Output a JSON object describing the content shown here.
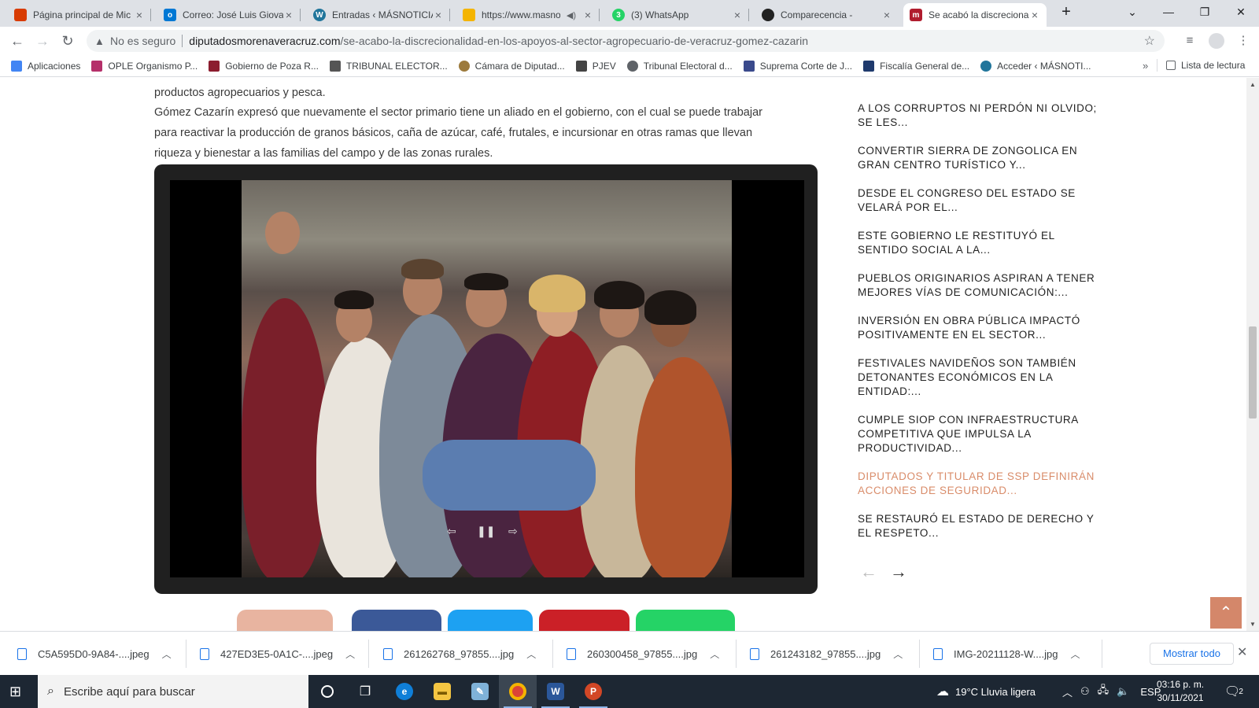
{
  "tabs": [
    {
      "title": "Página principal de Mic",
      "icon": "office-icon",
      "color": "#d83b01"
    },
    {
      "title": "Correo: José Luis Giova",
      "icon": "outlook-icon",
      "color": "#0078d4"
    },
    {
      "title": "Entradas ‹ MÁSNOTICIA",
      "icon": "wordpress-icon",
      "color": "#21759b"
    },
    {
      "title": "https://www.masno",
      "icon": "drive-icon",
      "color": "#f4b400"
    },
    {
      "title": "(3) WhatsApp",
      "icon": "whatsapp-icon",
      "color": "#25d366",
      "badge": "3"
    },
    {
      "title": "Comparecencia -",
      "icon": "camera-aperture-icon",
      "color": "#222222"
    },
    {
      "title": "Se acabó la discreciona",
      "icon": "morena-icon",
      "color": "#b01c2e",
      "badge": "m"
    }
  ],
  "toolbar": {
    "security_label": "No es seguro",
    "url_host": "diputadosmorenaveracruz.com",
    "url_path": "/se-acabo-la-discrecionalidad-en-los-apoyos-al-sector-agropecuario-de-veracruz-gomez-cazarin"
  },
  "bookmarks": [
    {
      "label": "Aplicaciones",
      "icon": "apps-grid-icon",
      "color": "#4285f4"
    },
    {
      "label": "OPLE Organismo P...",
      "icon": "ople-icon",
      "color": "#b5306a"
    },
    {
      "label": "Gobierno de Poza R...",
      "icon": "poza-rica-icon",
      "color": "#8c1d2f"
    },
    {
      "label": "TRIBUNAL ELECTOR...",
      "icon": "tribunal-icon",
      "color": "#555555"
    },
    {
      "label": "Cámara de Diputad...",
      "icon": "camara-icon",
      "color": "#9c7a3c"
    },
    {
      "label": "PJEV",
      "icon": "pjev-icon",
      "color": "#444444"
    },
    {
      "label": "Tribunal Electoral d...",
      "icon": "globe-icon",
      "color": "#5f6368"
    },
    {
      "label": "Suprema Corte de J...",
      "icon": "scjn-icon",
      "color": "#3a4a8c"
    },
    {
      "label": "Fiscalía General de...",
      "icon": "fiscalia-icon",
      "color": "#1f3a6d"
    },
    {
      "label": "Acceder ‹ MÁSNOTI...",
      "icon": "wordpress-icon",
      "color": "#21759b"
    }
  ],
  "reading_list_label": "Lista de lectura",
  "article": {
    "p1": "productos agropecuarios y pesca.",
    "p2_line1": "Gómez Cazarín expresó que nuevamente el sector primario tiene un aliado en el gobierno, con el cual se puede trabajar",
    "p2_line2": "para reactivar la producción de granos básicos, caña de azúcar, café, frutales, e incursionar en otras ramas que llevan",
    "p2_line3": "riqueza y bienestar a las familias del campo y de las zonas rurales."
  },
  "sidebar": {
    "items": [
      "A LOS CORRUPTOS NI PERDÓN NI OLVIDO; SE LES...",
      "CONVERTIR SIERRA DE ZONGOLICA EN GRAN CENTRO TURÍSTICO Y...",
      "DESDE EL CONGRESO DEL ESTADO SE VELARÁ POR EL...",
      "ESTE GOBIERNO LE RESTITUYÓ EL SENTIDO SOCIAL A LA...",
      "PUEBLOS ORIGINARIOS ASPIRAN A TENER MEJORES VÍAS DE COMUNICACIÓN:...",
      "INVERSIÓN EN OBRA PÚBLICA IMPACTÓ POSITIVAMENTE EN EL SECTOR...",
      "FESTIVALES NAVIDEÑOS SON TAMBIÉN DETONANTES ECONÓMICOS EN LA ENTIDAD:...",
      "CUMPLE SIOP CON INFRAESTRUCTURA COMPETITIVA QUE IMPULSA LA PRODUCTIVIDAD...",
      "DIPUTADOS Y TITULAR DE SSP DEFINIRÁN ACCIONES DE SEGURIDAD...",
      "SE RESTAURÓ EL ESTADO DE DERECHO Y EL RESPETO..."
    ],
    "highlighted_index": 8,
    "highlight_color": "#d98c6a"
  },
  "share_colors": [
    "#e8b4a0",
    "#3b5998",
    "#1da1f2",
    "#cb2027",
    "#25d366"
  ],
  "downloads": {
    "files": [
      "C5A595D0-9A84-....jpeg",
      "427ED3E5-0A1C-....jpeg",
      "261262768_97855....jpg",
      "260300458_97855....jpg",
      "261243182_97855....jpg",
      "IMG-20211128-W....jpg"
    ],
    "show_all_label": "Mostrar todo"
  },
  "taskbar": {
    "search_placeholder": "Escribe aquí para buscar",
    "weather": "19°C  Lluvia ligera",
    "language": "ESP",
    "time": "03:16 p. m.",
    "date": "30/11/2021",
    "notification_count": "2"
  }
}
